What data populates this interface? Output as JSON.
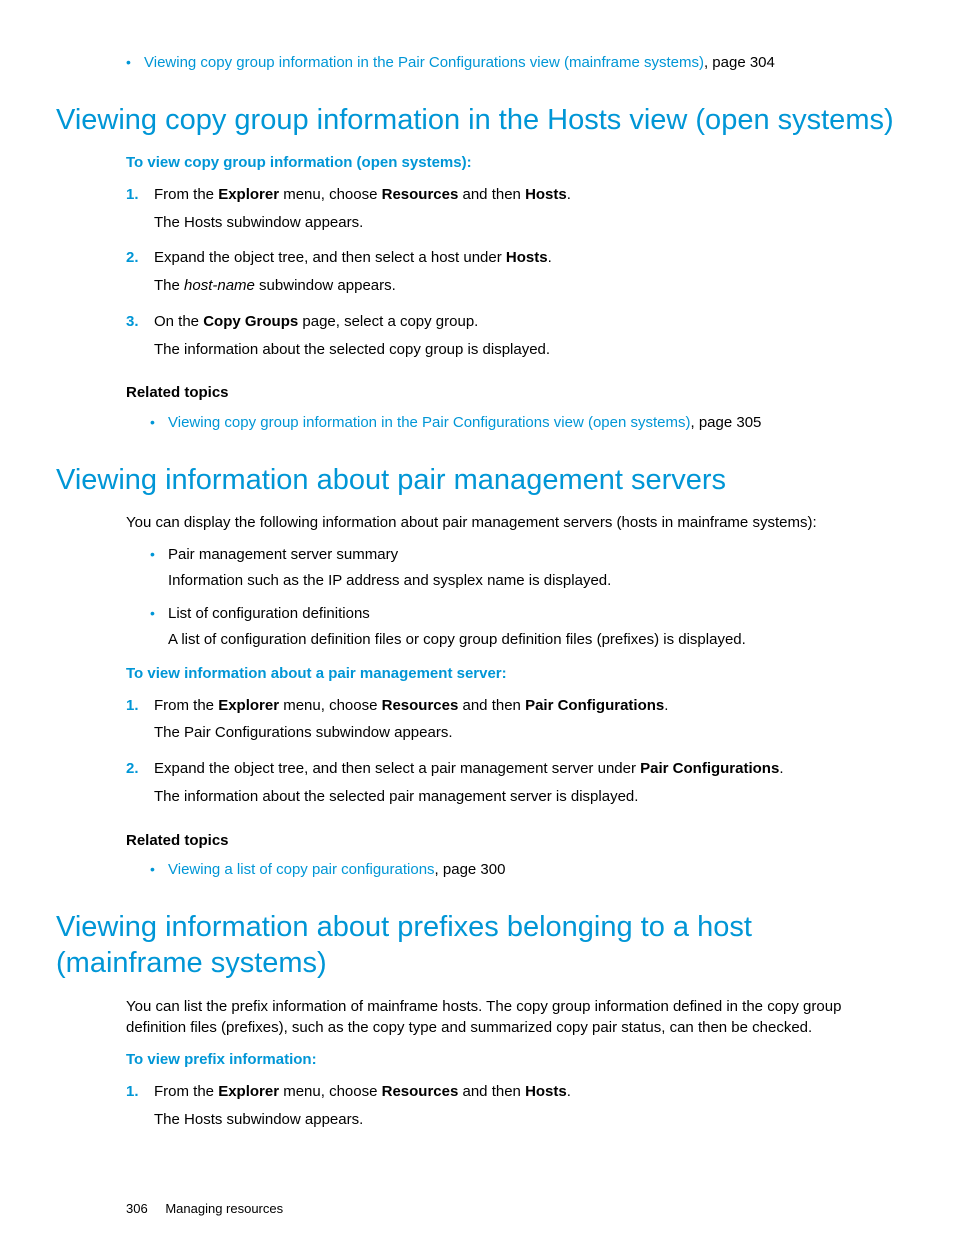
{
  "top_bullet": {
    "link": "Viewing copy group information in the Pair Configurations view (mainframe systems)",
    "suffix": ", page 304"
  },
  "s1": {
    "heading": "Viewing copy group information in the Hosts view (open systems)",
    "proc_title": "To view copy group information (open systems):",
    "step1_num": "1.",
    "step1_pre": "From the ",
    "step1_b1": "Explorer",
    "step1_mid1": " menu, choose ",
    "step1_b2": "Resources",
    "step1_mid2": " and then ",
    "step1_b3": "Hosts",
    "step1_end": ".",
    "step1_sub": "The Hosts subwindow appears.",
    "step2_num": "2.",
    "step2_pre": "Expand the object tree, and then select a host under ",
    "step2_b1": "Hosts",
    "step2_end": ".",
    "step2_sub_pre": "The ",
    "step2_sub_i": "host-name",
    "step2_sub_end": " subwindow appears.",
    "step3_num": "3.",
    "step3_pre": "On the ",
    "step3_b1": "Copy Groups",
    "step3_end": " page, select a copy group.",
    "step3_sub": "The information about the selected copy group is displayed.",
    "related_title": "Related topics",
    "related_link": "Viewing copy group information in the Pair Configurations view (open systems)",
    "related_suffix": ", page 305"
  },
  "s2": {
    "heading": "Viewing information about pair management servers",
    "intro": "You can display the following information about pair management servers (hosts in mainframe systems):",
    "b1": "Pair management server summary",
    "b1_sub": "Information such as the IP address and sysplex name is displayed.",
    "b2": "List of configuration definitions",
    "b2_sub": "A list of configuration definition files or copy group definition files (prefixes) is displayed.",
    "proc_title": "To view information about a pair management server:",
    "step1_num": "1.",
    "step1_pre": "From the ",
    "step1_b1": "Explorer",
    "step1_mid1": " menu, choose ",
    "step1_b2": "Resources",
    "step1_mid2": " and then ",
    "step1_b3": "Pair Configurations",
    "step1_end": ".",
    "step1_sub": "The Pair Configurations subwindow appears.",
    "step2_num": "2.",
    "step2_pre": "Expand the object tree, and then select a pair management server under ",
    "step2_b1": "Pair Configurations",
    "step2_end": ".",
    "step2_sub": "The information about the selected pair management server is displayed.",
    "related_title": "Related topics",
    "related_link": "Viewing a list of copy pair configurations",
    "related_suffix": ", page 300"
  },
  "s3": {
    "heading": "Viewing information about prefixes belonging to a host (mainframe systems)",
    "intro": "You can list the prefix information of mainframe hosts. The copy group information defined in the copy group definition files (prefixes), such as the copy type and summarized copy pair status, can then be checked.",
    "proc_title": "To view prefix information:",
    "step1_num": "1.",
    "step1_pre": "From the ",
    "step1_b1": "Explorer",
    "step1_mid1": " menu, choose ",
    "step1_b2": "Resources",
    "step1_mid2": " and then ",
    "step1_b3": "Hosts",
    "step1_end": ".",
    "step1_sub": "The Hosts subwindow appears."
  },
  "footer": {
    "page": "306",
    "title": "Managing resources"
  }
}
